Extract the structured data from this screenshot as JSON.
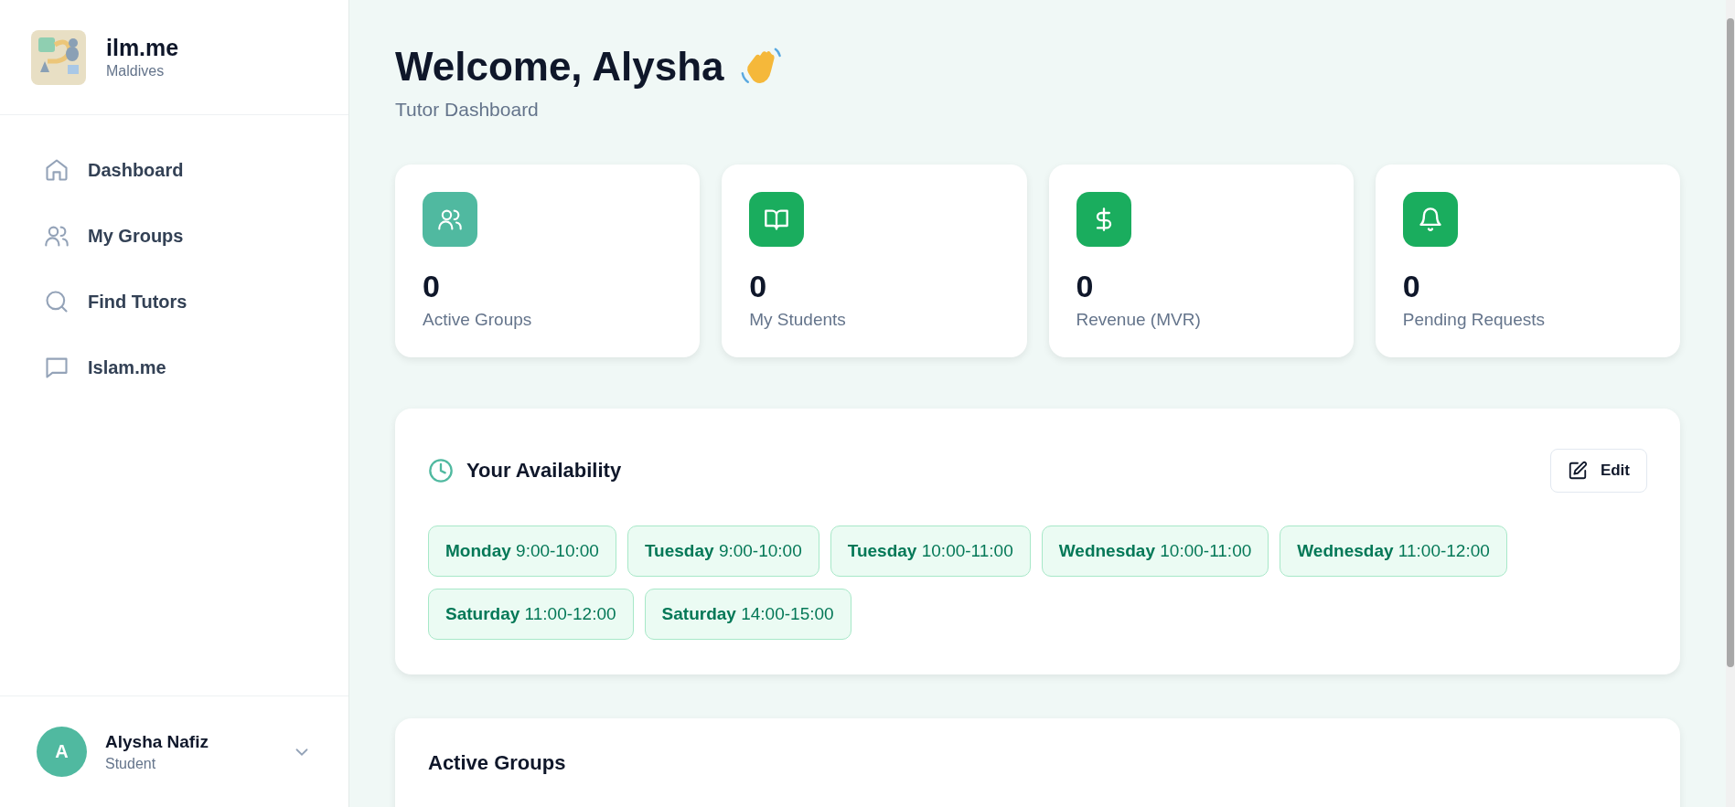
{
  "brand": {
    "name": "ilm.me",
    "subtitle": "Maldives"
  },
  "nav": [
    {
      "label": "Dashboard",
      "kind": "home"
    },
    {
      "label": "My Groups",
      "kind": "users"
    },
    {
      "label": "Find Tutors",
      "kind": "search"
    },
    {
      "label": "Islam.me",
      "kind": "chat"
    }
  ],
  "user": {
    "initial": "A",
    "name": "Alysha Nafiz",
    "role": "Student"
  },
  "header": {
    "title": "Welcome, Alysha",
    "subtitle": "Tutor Dashboard"
  },
  "stats": [
    {
      "value": "0",
      "label": "Active Groups",
      "kind": "users",
      "color": "#50b9a0"
    },
    {
      "value": "0",
      "label": "My Students",
      "kind": "book",
      "color": "#1aad5e"
    },
    {
      "value": "0",
      "label": "Revenue (MVR)",
      "kind": "dollar",
      "color": "#1aad5e"
    },
    {
      "value": "0",
      "label": "Pending Requests",
      "kind": "bell",
      "color": "#1aad5e"
    }
  ],
  "availability": {
    "title": "Your Availability",
    "edit_label": "Edit",
    "slots": [
      {
        "day": "Monday",
        "time": "9:00-10:00"
      },
      {
        "day": "Tuesday",
        "time": "9:00-10:00"
      },
      {
        "day": "Tuesday",
        "time": "10:00-11:00"
      },
      {
        "day": "Wednesday",
        "time": "10:00-11:00"
      },
      {
        "day": "Wednesday",
        "time": "11:00-12:00"
      },
      {
        "day": "Saturday",
        "time": "11:00-12:00"
      },
      {
        "day": "Saturday",
        "time": "14:00-15:00"
      }
    ]
  },
  "active_groups": {
    "title": "Active Groups"
  }
}
